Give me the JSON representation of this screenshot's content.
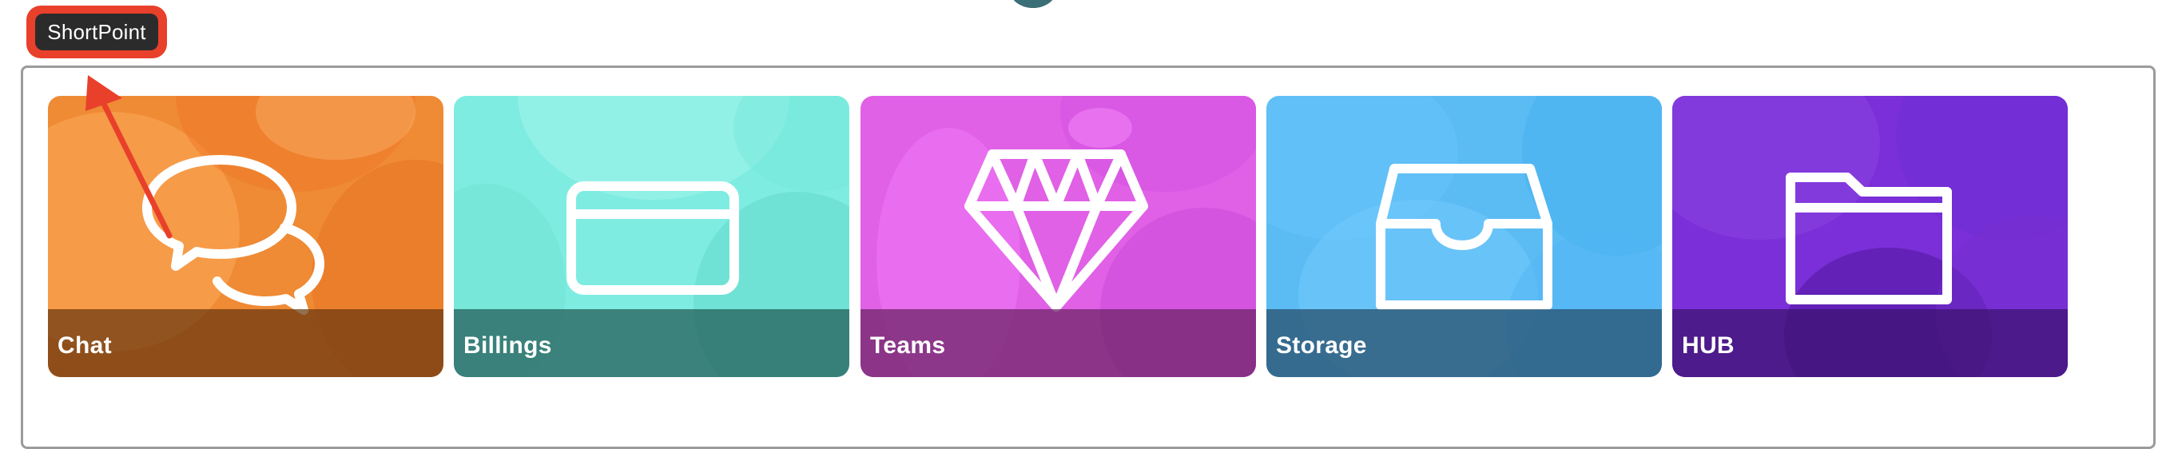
{
  "badge": {
    "label": "ShortPoint"
  },
  "tiles": [
    {
      "label": "Chat",
      "icon": "chat-bubbles-icon",
      "color": "#ef8a35"
    },
    {
      "label": "Billings",
      "icon": "credit-card-icon",
      "color": "#7eece1"
    },
    {
      "label": "Teams",
      "icon": "diamond-icon",
      "color": "#e060e6"
    },
    {
      "label": "Storage",
      "icon": "inbox-tray-icon",
      "color": "#5bbcf4"
    },
    {
      "label": "HUB",
      "icon": "folder-icon",
      "color": "#7a2fd8"
    }
  ],
  "annotation": {
    "color": "#e8402b"
  }
}
